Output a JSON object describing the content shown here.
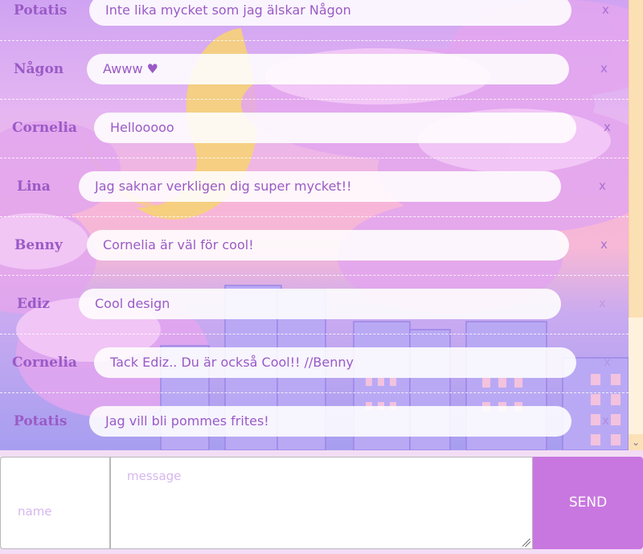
{
  "messages": [
    {
      "name": "Potatis",
      "text": "Inte lika mycket som jag älskar Någon",
      "delete": "x"
    },
    {
      "name": "Någon",
      "text": "Awww ♥",
      "delete": "x"
    },
    {
      "name": "Cornelia",
      "text": "Hellooooo",
      "delete": "x"
    },
    {
      "name": "Lina",
      "text": "Jag saknar verkligen dig super mycket!!",
      "delete": "x"
    },
    {
      "name": "Benny",
      "text": "Cornelia är väl för cool!",
      "delete": "x"
    },
    {
      "name": "Ediz",
      "text": "Cool design",
      "delete": "x"
    },
    {
      "name": "Cornelia",
      "text": "Tack Ediz.. Du är också Cool!! //Benny",
      "delete": "x"
    },
    {
      "name": "Potatis",
      "text": "Jag vill bli pommes frites!",
      "delete": "x"
    }
  ],
  "composer": {
    "name_placeholder": "name",
    "message_placeholder": "message",
    "send_label": "SEND"
  },
  "colors": {
    "accent": "#c977e0",
    "text": "#9a5ac6"
  },
  "icons": {
    "scroll_down": "chevron-down-icon"
  }
}
